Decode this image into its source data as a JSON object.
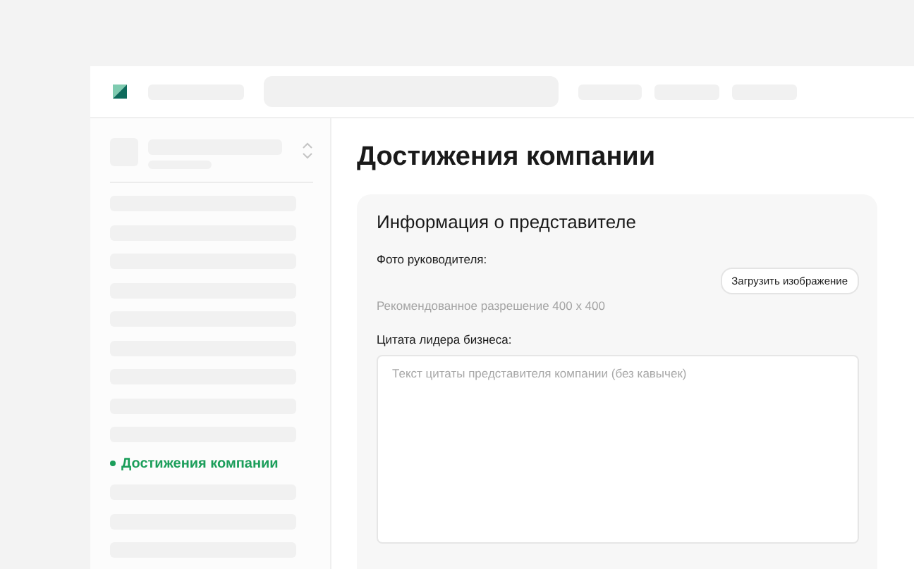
{
  "sidebar": {
    "items": [
      {
        "kind": "placeholder"
      },
      {
        "kind": "placeholder"
      },
      {
        "kind": "placeholder"
      },
      {
        "kind": "placeholder"
      },
      {
        "kind": "placeholder"
      },
      {
        "kind": "placeholder"
      },
      {
        "kind": "placeholder"
      },
      {
        "kind": "placeholder"
      },
      {
        "kind": "placeholder"
      },
      {
        "kind": "link",
        "label": "Достижения компании",
        "selected": true
      },
      {
        "kind": "placeholder"
      },
      {
        "kind": "placeholder"
      },
      {
        "kind": "placeholder"
      }
    ]
  },
  "page": {
    "title": "Достижения компании"
  },
  "card": {
    "title": "Информация о представителе",
    "photo_label": "Фото руководителя:",
    "upload_button": "Загрузить изображение",
    "photo_hint": "Рекомендованное разрешение 400 x 400",
    "quote_label": "Цитата лидера бизнеса:",
    "quote_placeholder": "Текст цитаты представителя компании (без кавычек)"
  }
}
